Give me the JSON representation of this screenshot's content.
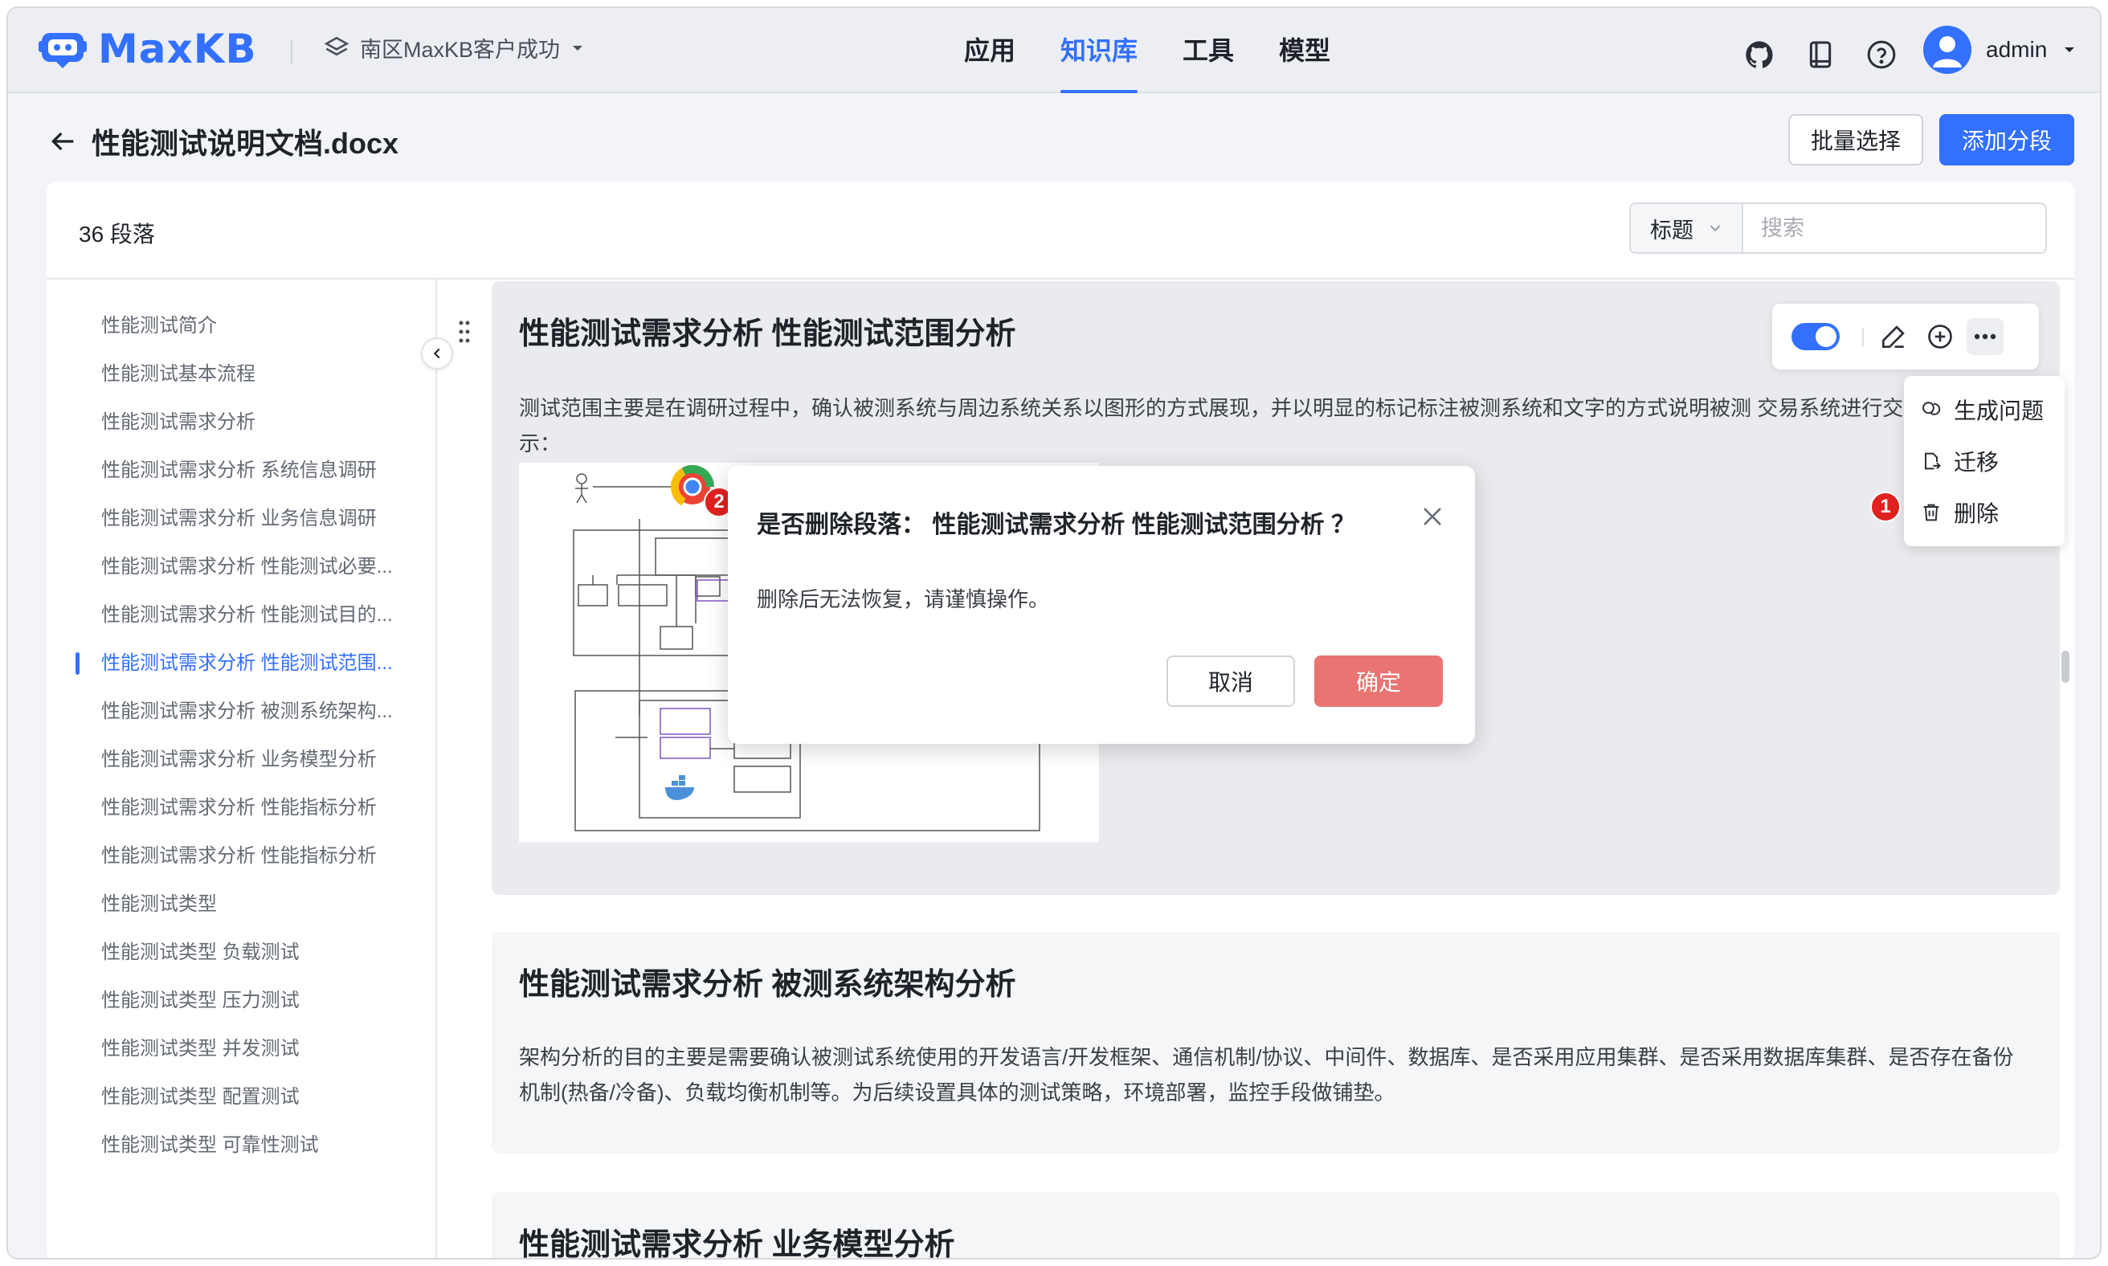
{
  "app": {
    "brand": "MaxKB",
    "workspace": "南区MaxKB客户成功"
  },
  "nav": {
    "items": [
      "应用",
      "知识库",
      "工具",
      "模型"
    ],
    "active": "知识库"
  },
  "user": {
    "name": "admin"
  },
  "document": {
    "title": "性能测试说明文档.docx",
    "batch_select": "批量选择",
    "add_segment": "添加分段"
  },
  "toolbar": {
    "segment_count": "36 段落",
    "filter_field": "标题",
    "search_placeholder": "搜索"
  },
  "outline": [
    "性能测试简介",
    "性能测试基本流程",
    "性能测试需求分析",
    "性能测试需求分析 系统信息调研",
    "性能测试需求分析 业务信息调研",
    "性能测试需求分析 性能测试必要...",
    "性能测试需求分析 性能测试目的...",
    "性能测试需求分析 性能测试范围...",
    "性能测试需求分析 被测系统架构...",
    "性能测试需求分析 业务模型分析",
    "性能测试需求分析 性能指标分析",
    "性能测试需求分析 性能指标分析",
    "性能测试类型",
    "性能测试类型 负载测试",
    "性能测试类型 压力测试",
    "性能测试类型 并发测试",
    "性能测试类型 配置测试",
    "性能测试类型 可靠性测试"
  ],
  "outline_active_index": 7,
  "segments": [
    {
      "title": "性能测试需求分析 性能测试范围分析",
      "text": "测试范围主要是在调研过程中，确认被测系统与周边系统关系以图形的方式展现，并以明显的标记标注被测系统和文字的方式说明被测 交易系统进行交互。如下图所示："
    },
    {
      "title": "性能测试需求分析 被测系统架构分析",
      "text": "架构分析的目的主要是需要确认被测试系统使用的开发语言/开发框架、通信机制/协议、中间件、数据库、是否采用应用集群、是否采用数据库集群、是否存在备份机制(热备/冷备)、负载均衡机制等。为后续设置具体的测试策略，环境部署，监控手段做铺垫。"
    },
    {
      "title": "性能测试需求分析 业务模型分析"
    }
  ],
  "dropdown": {
    "items": [
      "生成问题",
      "迁移",
      "删除"
    ]
  },
  "markers": {
    "m1": "1",
    "m2": "2"
  },
  "dialog": {
    "title": "是否删除段落： 性能测试需求分析 性能测试范围分析 ？",
    "body": "删除后无法恢复，请谨慎操作。",
    "cancel": "取消",
    "confirm": "确定"
  },
  "colors": {
    "primary": "#3370ff",
    "danger": "#e87572",
    "badge": "#e0211f"
  }
}
